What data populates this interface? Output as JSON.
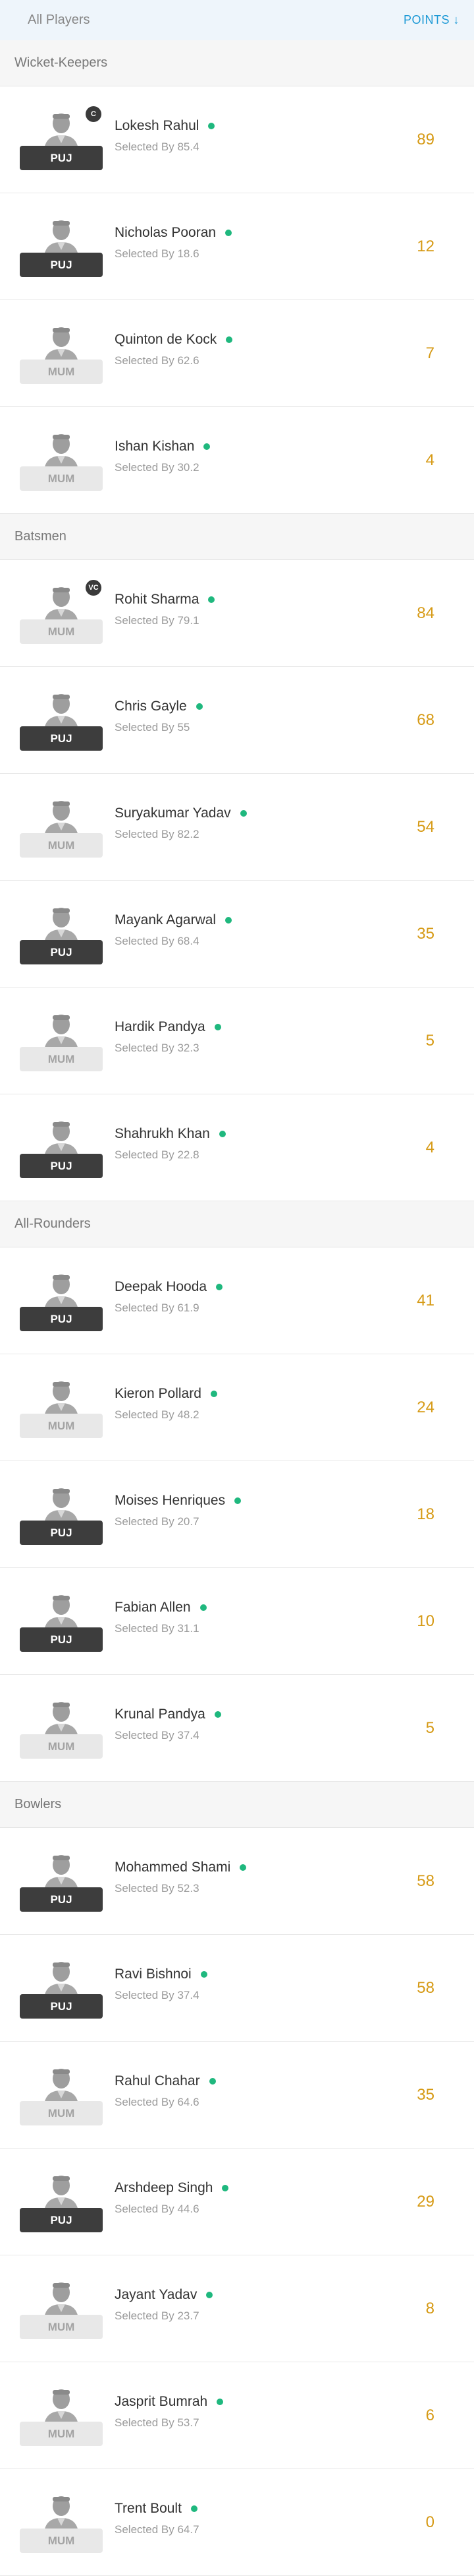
{
  "header": {
    "title": "All Players",
    "sort_label": "POINTS ↓"
  },
  "colors": {
    "accent": "#1e9ad6",
    "points": "#d69a15",
    "playing_dot": "#1fb87e"
  },
  "icons": {
    "avatar": "person-silhouette-icon",
    "status": "playing-dot-icon"
  },
  "sections": [
    {
      "title": "Wicket-Keepers",
      "players": [
        {
          "name": "Lokesh Rahul",
          "selected": "Selected By 85.4",
          "team": "PUJ",
          "points": "89",
          "badge": "C"
        },
        {
          "name": "Nicholas Pooran",
          "selected": "Selected By 18.6",
          "team": "PUJ",
          "points": "12",
          "badge": ""
        },
        {
          "name": "Quinton de Kock",
          "selected": "Selected By 62.6",
          "team": "MUM",
          "points": "7",
          "badge": ""
        },
        {
          "name": "Ishan Kishan",
          "selected": "Selected By 30.2",
          "team": "MUM",
          "points": "4",
          "badge": ""
        }
      ]
    },
    {
      "title": "Batsmen",
      "players": [
        {
          "name": "Rohit Sharma",
          "selected": "Selected By 79.1",
          "team": "MUM",
          "points": "84",
          "badge": "VC"
        },
        {
          "name": "Chris Gayle",
          "selected": "Selected By 55",
          "team": "PUJ",
          "points": "68",
          "badge": ""
        },
        {
          "name": "Suryakumar Yadav",
          "selected": "Selected By 82.2",
          "team": "MUM",
          "points": "54",
          "badge": ""
        },
        {
          "name": "Mayank Agarwal",
          "selected": "Selected By 68.4",
          "team": "PUJ",
          "points": "35",
          "badge": ""
        },
        {
          "name": "Hardik Pandya",
          "selected": "Selected By 32.3",
          "team": "MUM",
          "points": "5",
          "badge": ""
        },
        {
          "name": "Shahrukh Khan",
          "selected": "Selected By 22.8",
          "team": "PUJ",
          "points": "4",
          "badge": ""
        }
      ]
    },
    {
      "title": "All-Rounders",
      "players": [
        {
          "name": "Deepak Hooda",
          "selected": "Selected By 61.9",
          "team": "PUJ",
          "points": "41",
          "badge": ""
        },
        {
          "name": "Kieron Pollard",
          "selected": "Selected By 48.2",
          "team": "MUM",
          "points": "24",
          "badge": ""
        },
        {
          "name": "Moises Henriques",
          "selected": "Selected By 20.7",
          "team": "PUJ",
          "points": "18",
          "badge": ""
        },
        {
          "name": "Fabian Allen",
          "selected": "Selected By 31.1",
          "team": "PUJ",
          "points": "10",
          "badge": ""
        },
        {
          "name": "Krunal Pandya",
          "selected": "Selected By 37.4",
          "team": "MUM",
          "points": "5",
          "badge": ""
        }
      ]
    },
    {
      "title": "Bowlers",
      "players": [
        {
          "name": "Mohammed Shami",
          "selected": "Selected By 52.3",
          "team": "PUJ",
          "points": "58",
          "badge": ""
        },
        {
          "name": "Ravi Bishnoi",
          "selected": "Selected By 37.4",
          "team": "PUJ",
          "points": "58",
          "badge": ""
        },
        {
          "name": "Rahul Chahar",
          "selected": "Selected By 64.6",
          "team": "MUM",
          "points": "35",
          "badge": ""
        },
        {
          "name": "Arshdeep Singh",
          "selected": "Selected By 44.6",
          "team": "PUJ",
          "points": "29",
          "badge": ""
        },
        {
          "name": "Jayant Yadav",
          "selected": "Selected By 23.7",
          "team": "MUM",
          "points": "8",
          "badge": ""
        },
        {
          "name": "Jasprit Bumrah",
          "selected": "Selected By 53.7",
          "team": "MUM",
          "points": "6",
          "badge": ""
        },
        {
          "name": "Trent Boult",
          "selected": "Selected By 64.7",
          "team": "MUM",
          "points": "0",
          "badge": ""
        }
      ]
    }
  ]
}
